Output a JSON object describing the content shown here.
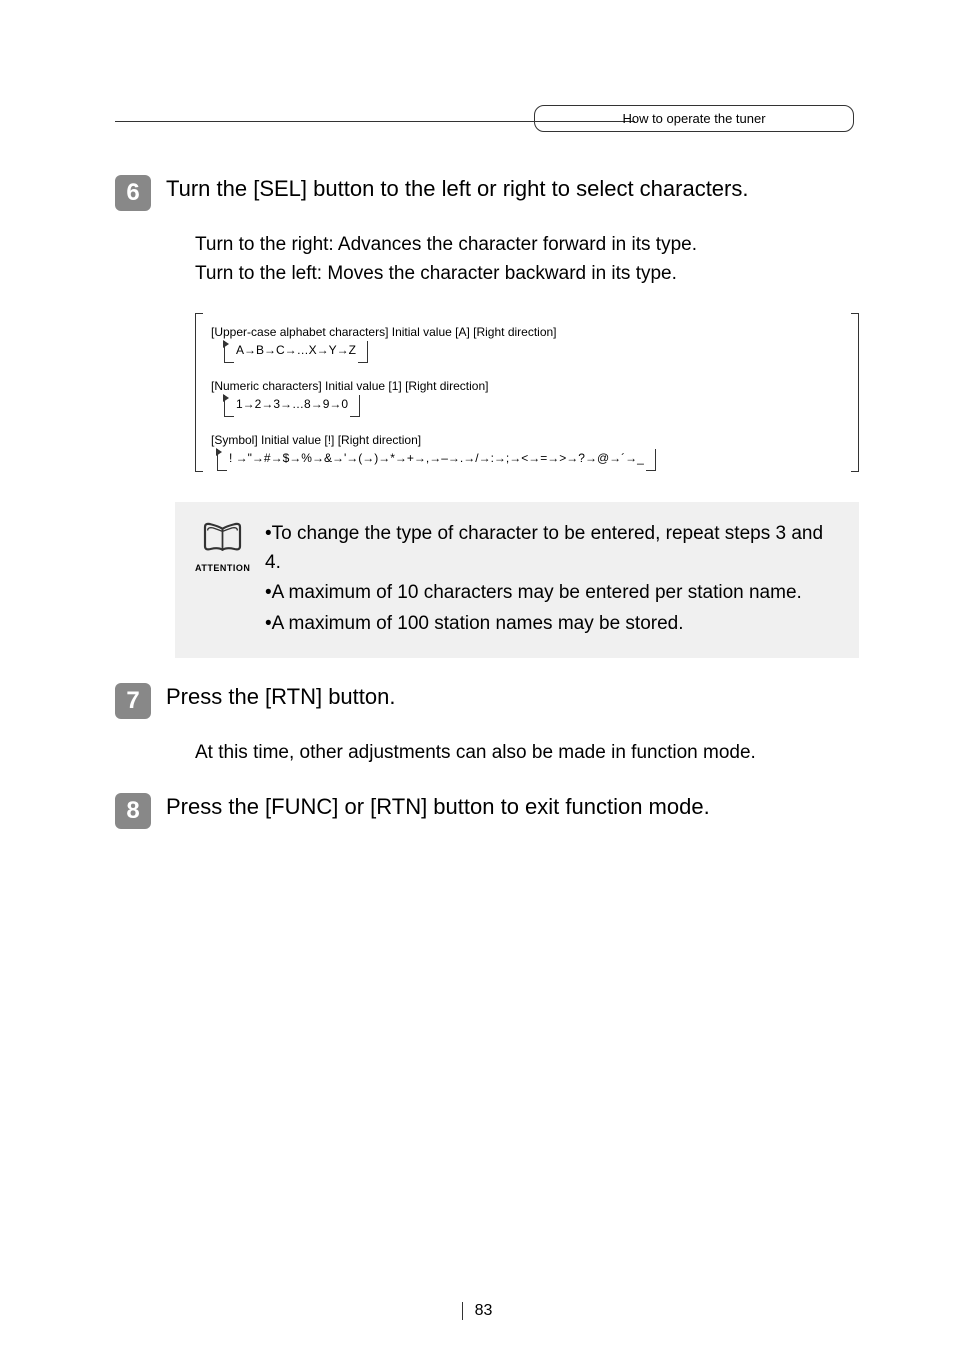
{
  "header": {
    "label": "How to operate the tuner"
  },
  "steps": [
    {
      "num": "6",
      "title": "Turn the [SEL] button to the left or right to select characters.",
      "body_line1": "Turn to the right:  Advances the character forward in its type.",
      "body_line2": "Turn to the left:    Moves the character backward in its type."
    },
    {
      "num": "7",
      "title": "Press the [RTN] button.",
      "body": "At this time, other adjustments can also be made in function mode."
    },
    {
      "num": "8",
      "title": "Press the [FUNC] or [RTN] button to exit function mode."
    }
  ],
  "charDiagram": {
    "rows": [
      {
        "label": "[Upper-case alphabet characters] Initial value [A]     [Right direction]",
        "sequence": "A→B→C→…X→Y→Z"
      },
      {
        "label": "[Numeric characters] Initial value [1]     [Right direction]",
        "sequence": "1→2→3→…8→9→0"
      },
      {
        "label": "[Symbol] Initial value [!]     [Right direction]",
        "sequence": " ! →\"→#→$→%→&→'→(→)→*→+→,→–→.→/→:→;→<→=→>→?→@→´→_"
      }
    ]
  },
  "attention": {
    "label": "ATTENTION",
    "bullets": [
      "•To change the type of character to be entered, repeat steps 3 and 4.",
      "•A maximum of 10 characters may be entered per station name.",
      "•A maximum of 100 station names may be stored."
    ]
  },
  "pageNum": "83"
}
